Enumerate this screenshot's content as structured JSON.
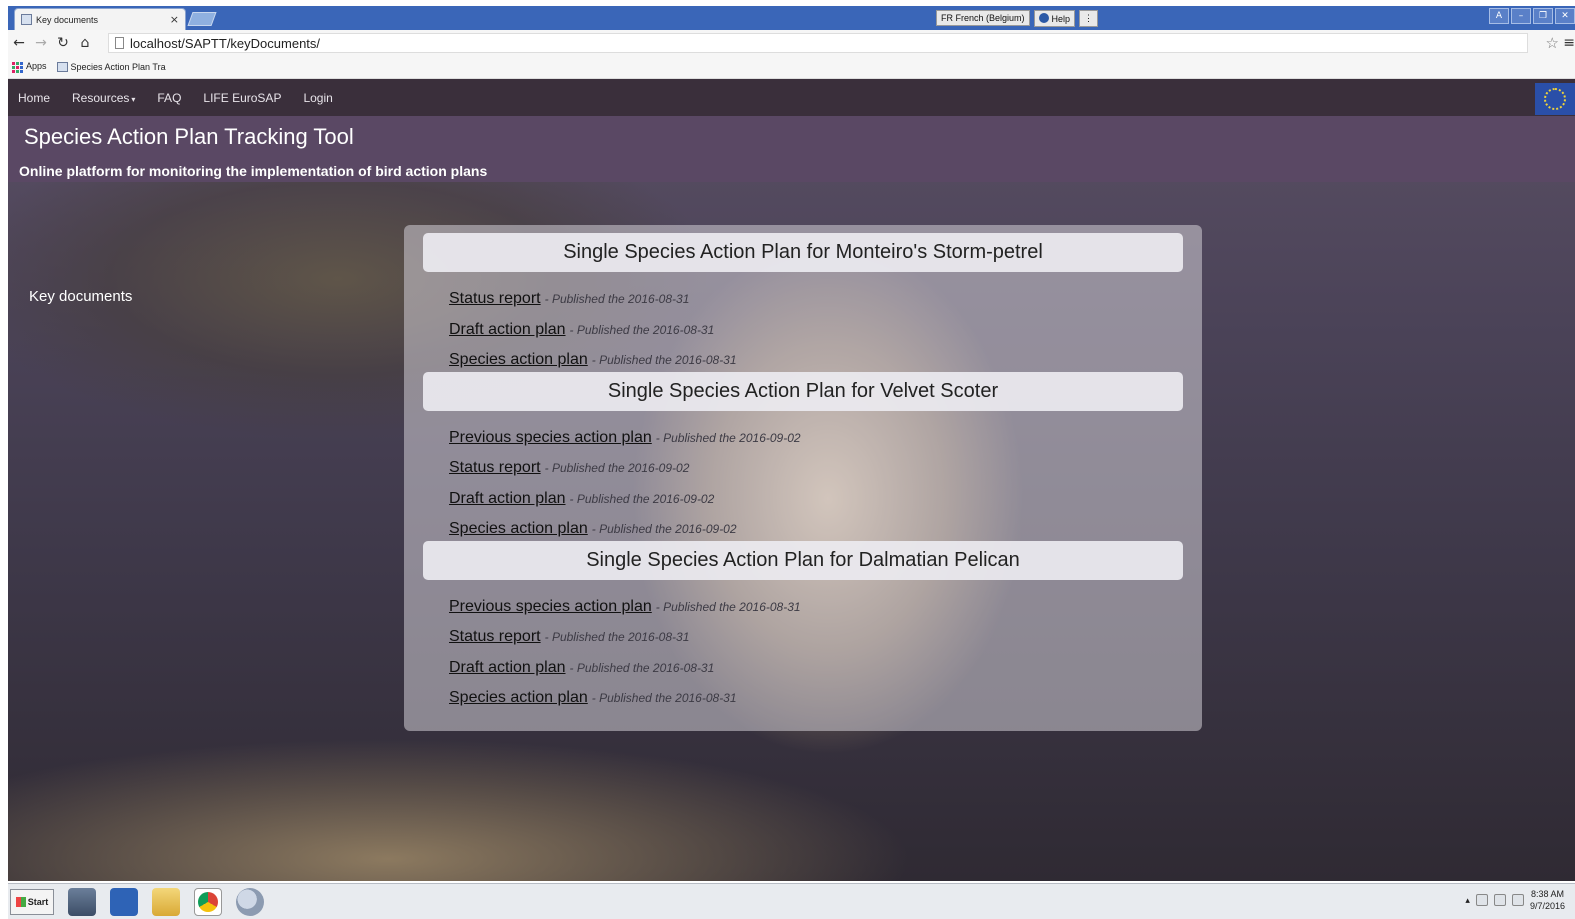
{
  "browser": {
    "tab_title": "Key documents",
    "tab_close": "×",
    "url": "localhost/SAPTT/keyDocuments/",
    "language_indicator": "FR French (Belgium)",
    "help_label": "Help",
    "bookmarks": [
      "Apps",
      "Species Action Plan Tra"
    ]
  },
  "navbar": {
    "items": [
      {
        "label": "Home"
      },
      {
        "label": "Resources",
        "caret": "▾"
      },
      {
        "label": "FAQ"
      },
      {
        "label": "LIFE EuroSAP"
      },
      {
        "label": "Login"
      }
    ]
  },
  "banner": {
    "title": "Species Action Plan Tracking Tool",
    "subtitle": "Online platform for monitoring the implementation of bird action plans"
  },
  "sidebar": {
    "heading": "Key documents"
  },
  "plans": [
    {
      "title": "Single Species Action Plan for Monteiro's Storm-petrel",
      "documents": [
        {
          "name": "Status report",
          "published": "- Published the 2016-08-31"
        },
        {
          "name": "Draft action plan",
          "published": "- Published the 2016-08-31"
        },
        {
          "name": "Species action plan",
          "published": "- Published the 2016-08-31"
        }
      ]
    },
    {
      "title": "Single Species Action Plan for Velvet Scoter",
      "documents": [
        {
          "name": "Previous species action plan",
          "published": "- Published the 2016-09-02"
        },
        {
          "name": "Status report",
          "published": "- Published the 2016-09-02"
        },
        {
          "name": "Draft action plan",
          "published": "- Published the 2016-09-02"
        },
        {
          "name": "Species action plan",
          "published": "- Published the 2016-09-02"
        }
      ]
    },
    {
      "title": "Single Species Action Plan for Dalmatian Pelican",
      "documents": [
        {
          "name": "Previous species action plan",
          "published": "- Published the 2016-08-31"
        },
        {
          "name": "Status report",
          "published": "- Published the 2016-08-31"
        },
        {
          "name": "Draft action plan",
          "published": "- Published the 2016-08-31"
        },
        {
          "name": "Species action plan",
          "published": "- Published the 2016-08-31"
        }
      ]
    }
  ],
  "taskbar": {
    "start_label": "Start",
    "time": "8:38 AM",
    "date": "9/7/2016"
  },
  "colors": {
    "navbar": "#3a2f3b",
    "banner": "#5a4864",
    "browser_tabstrip": "#3a66b8"
  }
}
